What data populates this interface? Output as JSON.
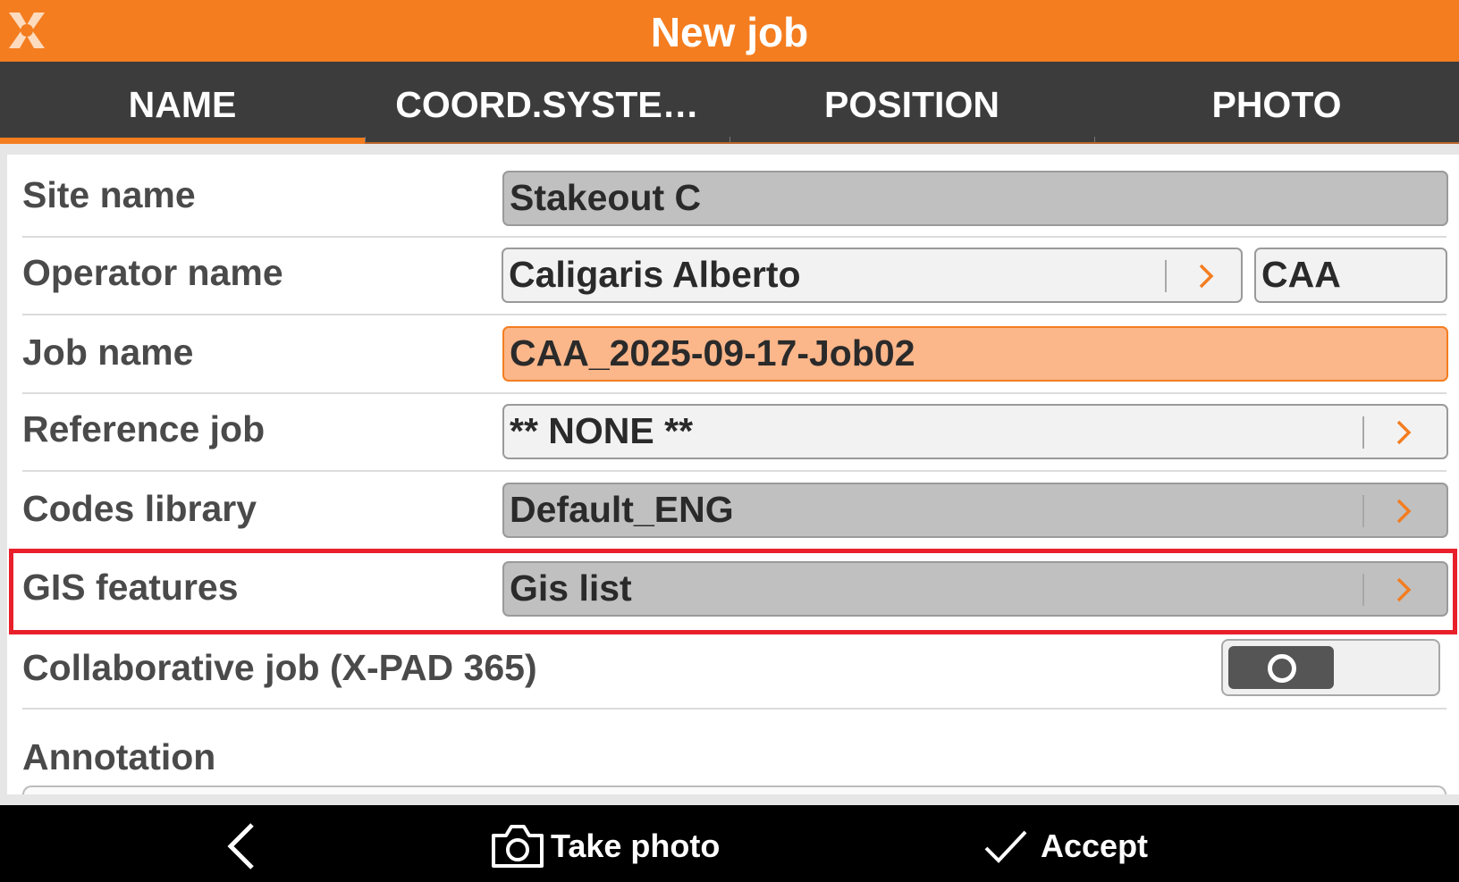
{
  "header": {
    "title": "New job",
    "logo": "xpad-logo-icon"
  },
  "tabs": [
    {
      "label": "NAME",
      "active": true
    },
    {
      "label": "COORD.SYSTE…",
      "active": false
    },
    {
      "label": "POSITION",
      "active": false
    },
    {
      "label": "PHOTO",
      "active": false
    }
  ],
  "form": {
    "site_name": {
      "label": "Site name",
      "value": "Stakeout C"
    },
    "operator_name": {
      "label": "Operator name",
      "value": "Caligaris Alberto",
      "initials": "CAA"
    },
    "job_name": {
      "label": "Job name",
      "value": "CAA_2025-09-17-Job02"
    },
    "reference_job": {
      "label": "Reference job",
      "value": "** NONE **"
    },
    "codes_library": {
      "label": "Codes library",
      "value": "Default_ENG"
    },
    "gis_features": {
      "label": "GIS features",
      "value": "Gis list"
    },
    "collaborative_job": {
      "label": "Collaborative job (X-PAD 365)",
      "enabled": false
    },
    "annotation": {
      "label": "Annotation",
      "value": ""
    }
  },
  "bottom_bar": {
    "back_icon": "chevron-left-icon",
    "take_photo_label": "Take photo",
    "take_photo_icon": "camera-icon",
    "accept_label": "Accept",
    "accept_icon": "checkmark-icon"
  },
  "colors": {
    "accent": "#f47d20",
    "tab_bar": "#3c3c3c",
    "field_disabled": "#c0c0c0",
    "field_active": "#fbb68a",
    "highlight": "#e8202a"
  }
}
